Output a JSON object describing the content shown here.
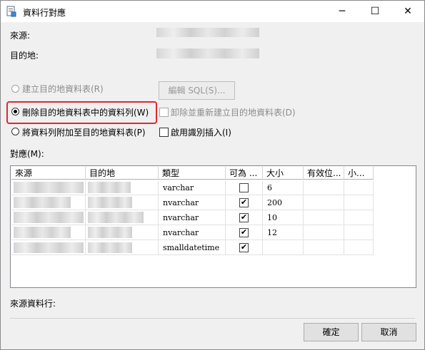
{
  "window": {
    "title": "資料行對應",
    "min_glyph": "─",
    "max_glyph": "☐",
    "close_glyph": "✕"
  },
  "labels": {
    "source": "來源:",
    "destination": "目的地:",
    "mappings": "對應(M):",
    "source_column": "來源資料行:"
  },
  "options": {
    "create_table": "建立目的地資料表(R)",
    "edit_sql_button": "編輯 SQL(S)...",
    "delete_rows": "刪除目的地資料表中的資料列(W)",
    "drop_recreate": "卸除並重新建立目的地資料表(D)",
    "append_rows": "將資料列附加至目的地資料表(P)",
    "identity_insert": "啟用識別插入(I)"
  },
  "grid": {
    "headers": [
      "來源",
      "目的地",
      "類型",
      "可為 ...",
      "大小",
      "有效位...",
      "小..."
    ],
    "rows": [
      {
        "type": "varchar",
        "nullable": false,
        "size": "6"
      },
      {
        "type": "nvarchar",
        "nullable": true,
        "size": "200"
      },
      {
        "type": "nvarchar",
        "nullable": true,
        "size": "10"
      },
      {
        "type": "nvarchar",
        "nullable": true,
        "size": "12"
      },
      {
        "type": "smalldatetime",
        "nullable": true,
        "size": ""
      }
    ]
  },
  "buttons": {
    "ok": "確定",
    "cancel": "取消"
  },
  "check_glyph": "✔",
  "colors": {
    "highlight": "#e0282e"
  }
}
